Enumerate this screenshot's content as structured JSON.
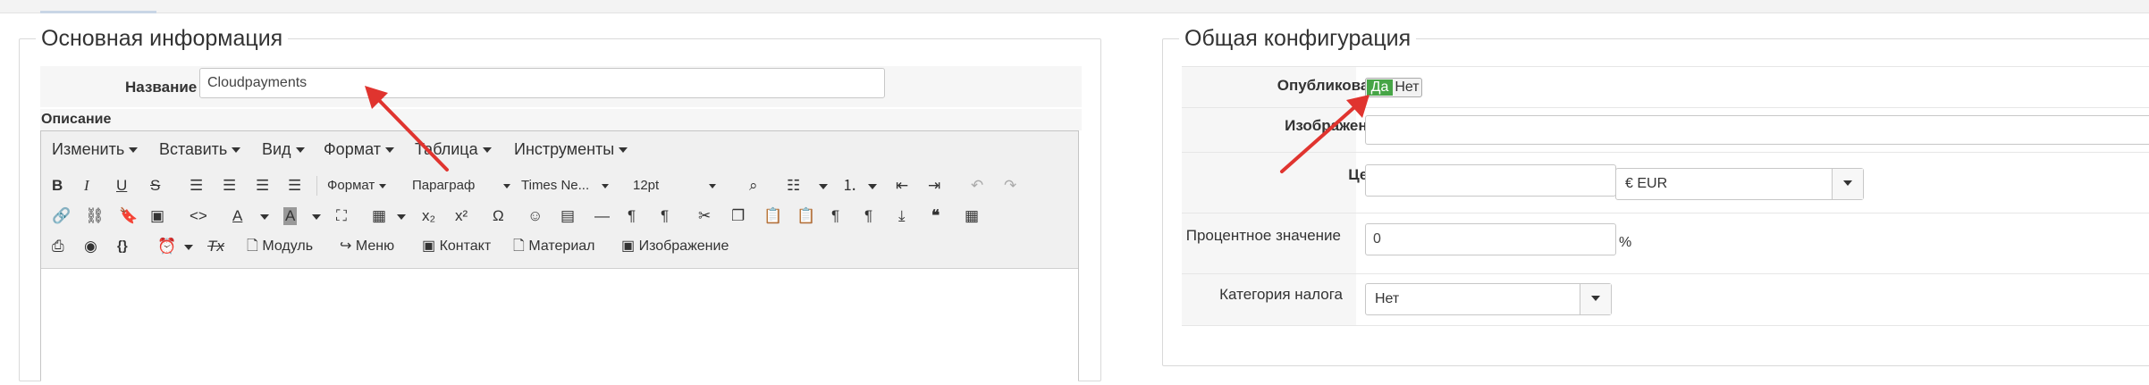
{
  "main_panel": {
    "legend": "Основная информация",
    "name_label": "Название",
    "name_value": "Cloudpayments",
    "description_label": "Описание"
  },
  "editor": {
    "menu": [
      "Изменить",
      "Вставить",
      "Вид",
      "Формат",
      "Таблица",
      "Инструменты"
    ],
    "format_dropdown": "Формат",
    "paragraph_dropdown": "Параграф",
    "font_dropdown": "Times Ne...",
    "size_dropdown": "12pt",
    "module_button": "Модуль",
    "menu_button": "Меню",
    "contact_button": "Контакт",
    "material_button": "Материал",
    "image_button": "Изображение"
  },
  "config_panel": {
    "legend": "Общая конфигурация",
    "published_label": "Опубликовано",
    "yes": "Да",
    "no": "Нет",
    "images_label": "Изображения",
    "price_label": "Цена",
    "currency_value": "€ EUR",
    "percent_label": "Процентное значение",
    "percent_value": "0",
    "percent_sign": "%",
    "tax_label": "Категория налога",
    "tax_value": "Нет"
  },
  "colors": {
    "toggle_active": "#46a546",
    "arrow": "#e0342f"
  },
  "icons": [
    "bold-icon",
    "italic-icon",
    "underline-icon",
    "strikethrough-icon",
    "align-left-icon",
    "align-center-icon",
    "align-right-icon",
    "align-justify-icon",
    "find-icon",
    "bullet-list-icon",
    "numbered-list-icon",
    "outdent-icon",
    "indent-icon",
    "undo-icon",
    "redo-icon",
    "link-icon",
    "unlink-icon",
    "anchor-icon",
    "image-icon",
    "code-icon",
    "text-color-icon",
    "background-color-icon",
    "fullscreen-icon",
    "table-icon",
    "subscript-icon",
    "superscript-icon",
    "omega-icon",
    "emoticon-icon",
    "media-icon",
    "horizontal-rule-icon",
    "ltr-icon",
    "rtl-icon",
    "cut-icon",
    "copy-icon",
    "paste-icon",
    "paste-text-icon",
    "paragraph-icon",
    "blocks-icon",
    "insert-file-icon",
    "blockquote-icon",
    "template-icon",
    "print-icon",
    "preview-icon",
    "code-sample-icon",
    "clock-icon",
    "clear-format-icon"
  ]
}
